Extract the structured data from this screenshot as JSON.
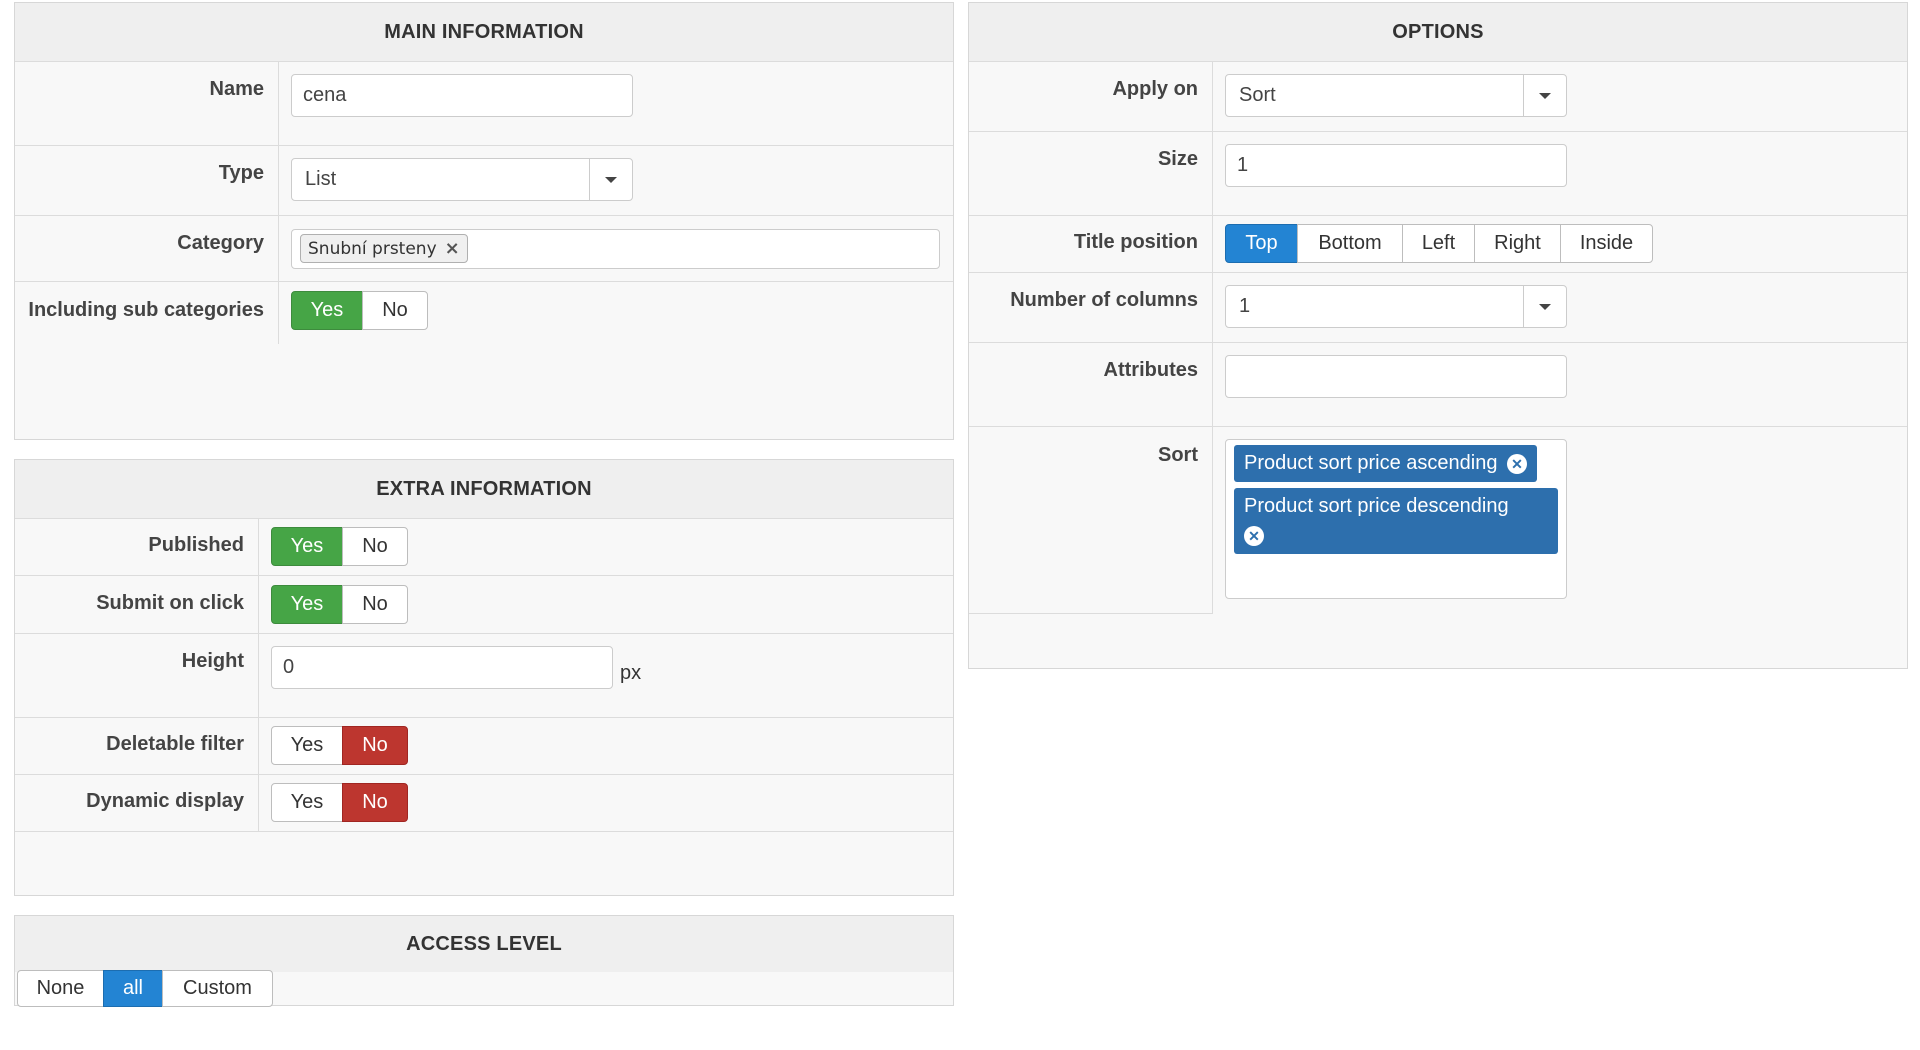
{
  "main_info": {
    "title": "MAIN INFORMATION",
    "name_label": "Name",
    "name_value": "cena",
    "type_label": "Type",
    "type_value": "List",
    "category_label": "Category",
    "category_tag": "Snubní prsteny",
    "sub_label": "Including sub categories",
    "yes": "Yes",
    "no": "No"
  },
  "extra_info": {
    "title": "EXTRA INFORMATION",
    "published_label": "Published",
    "submit_label": "Submit on click",
    "height_label": "Height",
    "height_value": "0",
    "height_unit": "px",
    "deletable_label": "Deletable filter",
    "dynamic_label": "Dynamic display",
    "yes": "Yes",
    "no": "No"
  },
  "access": {
    "title": "ACCESS LEVEL",
    "options": [
      "None",
      "all",
      "Custom"
    ],
    "selected": "all"
  },
  "options": {
    "title": "OPTIONS",
    "apply_label": "Apply on",
    "apply_value": "Sort",
    "size_label": "Size",
    "size_value": "1",
    "title_pos_label": "Title position",
    "title_positions": [
      "Top",
      "Bottom",
      "Left",
      "Right",
      "Inside"
    ],
    "title_pos_selected": "Top",
    "columns_label": "Number of columns",
    "columns_value": "1",
    "attributes_label": "Attributes",
    "attributes_value": "",
    "sort_label": "Sort",
    "sort_tags": [
      "Product sort price ascending",
      "Product sort price descending"
    ]
  },
  "colors": {
    "yes_active": "#46a546",
    "no_active": "#bd362f",
    "selected_blue": "#2384d3",
    "tag_blue": "#2d6fad"
  },
  "icons": {
    "dropdown": "caret-down-icon",
    "remove_chip": "x-icon",
    "remove_tag": "x-circle-icon"
  }
}
